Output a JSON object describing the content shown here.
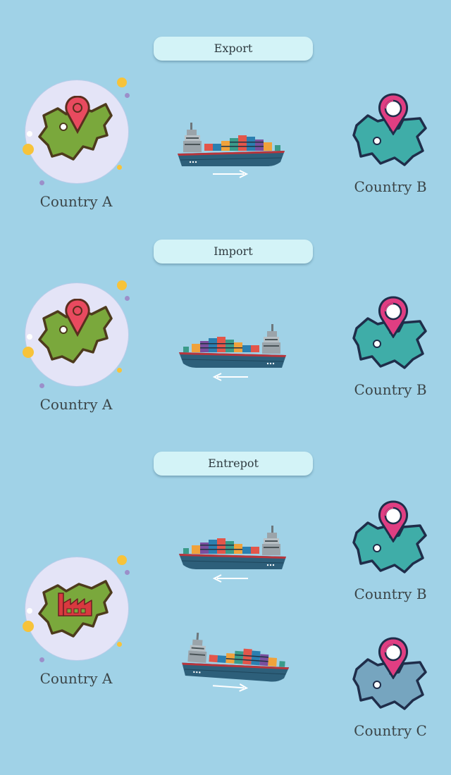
{
  "sections": [
    {
      "title": "Export",
      "origin": "Country A",
      "destinations": [
        "Country B"
      ],
      "direction": "right"
    },
    {
      "title": "Import",
      "origin": "Country A",
      "destinations": [
        "Country B"
      ],
      "direction": "left"
    },
    {
      "title": "Entrepot",
      "origin": "Country A",
      "destinations": [
        "Country B",
        "Country C"
      ],
      "direction": "both"
    }
  ],
  "colors": {
    "background": "#a0d2e7",
    "pill": "#d3f3f7",
    "country_a": "#7aa83c",
    "country_b": "#3fada8",
    "country_c": "#76a5bf",
    "pin_red": "#e84a5f",
    "pin_pink": "#e03e82",
    "ship_hull": "#2d5f7a"
  },
  "icons": [
    "map-pin-icon",
    "factory-icon",
    "cargo-ship-icon",
    "arrow-right-icon",
    "arrow-left-icon"
  ]
}
